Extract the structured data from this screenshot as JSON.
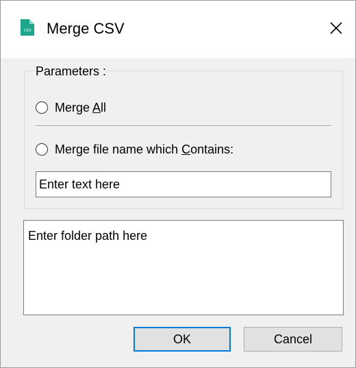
{
  "window": {
    "title": "Merge CSV",
    "app_icon": "csv-file-icon",
    "close_icon": "close-icon"
  },
  "parameters": {
    "group_label": "Parameters :",
    "merge_all": {
      "prefix": "Merge ",
      "underline": "A",
      "suffix": "ll",
      "selected": false
    },
    "merge_contains": {
      "prefix": "Merge file name which ",
      "underline": "C",
      "suffix": "ontains:",
      "selected": false
    },
    "filter_input": {
      "placeholder": "Enter text here",
      "value": ""
    }
  },
  "folder_path": {
    "placeholder": "Enter folder path here",
    "value": ""
  },
  "buttons": {
    "ok_label": "OK",
    "cancel_label": "Cancel"
  },
  "colors": {
    "accent": "#0078d7",
    "icon_green": "#1ea58a",
    "window_bg": "#f0f0f0"
  }
}
